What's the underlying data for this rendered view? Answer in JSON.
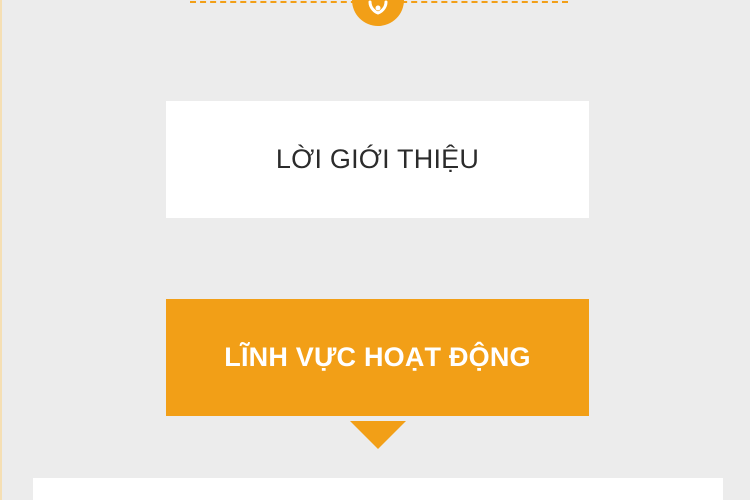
{
  "tabs": [
    {
      "label": "LỜI GIỚI THIỆU",
      "active": false
    },
    {
      "label": "LĨNH VỰC HOẠT ĐỘNG",
      "active": true
    }
  ],
  "icons": {
    "divider_badge": "flower-icon",
    "active_pointer": "triangle-down-icon"
  },
  "colors": {
    "accent": "#f29f17",
    "background": "#ececec",
    "tab_inactive_bg": "#ffffff",
    "tab_inactive_text": "#2b2b2b",
    "tab_active_text": "#ffffff"
  }
}
